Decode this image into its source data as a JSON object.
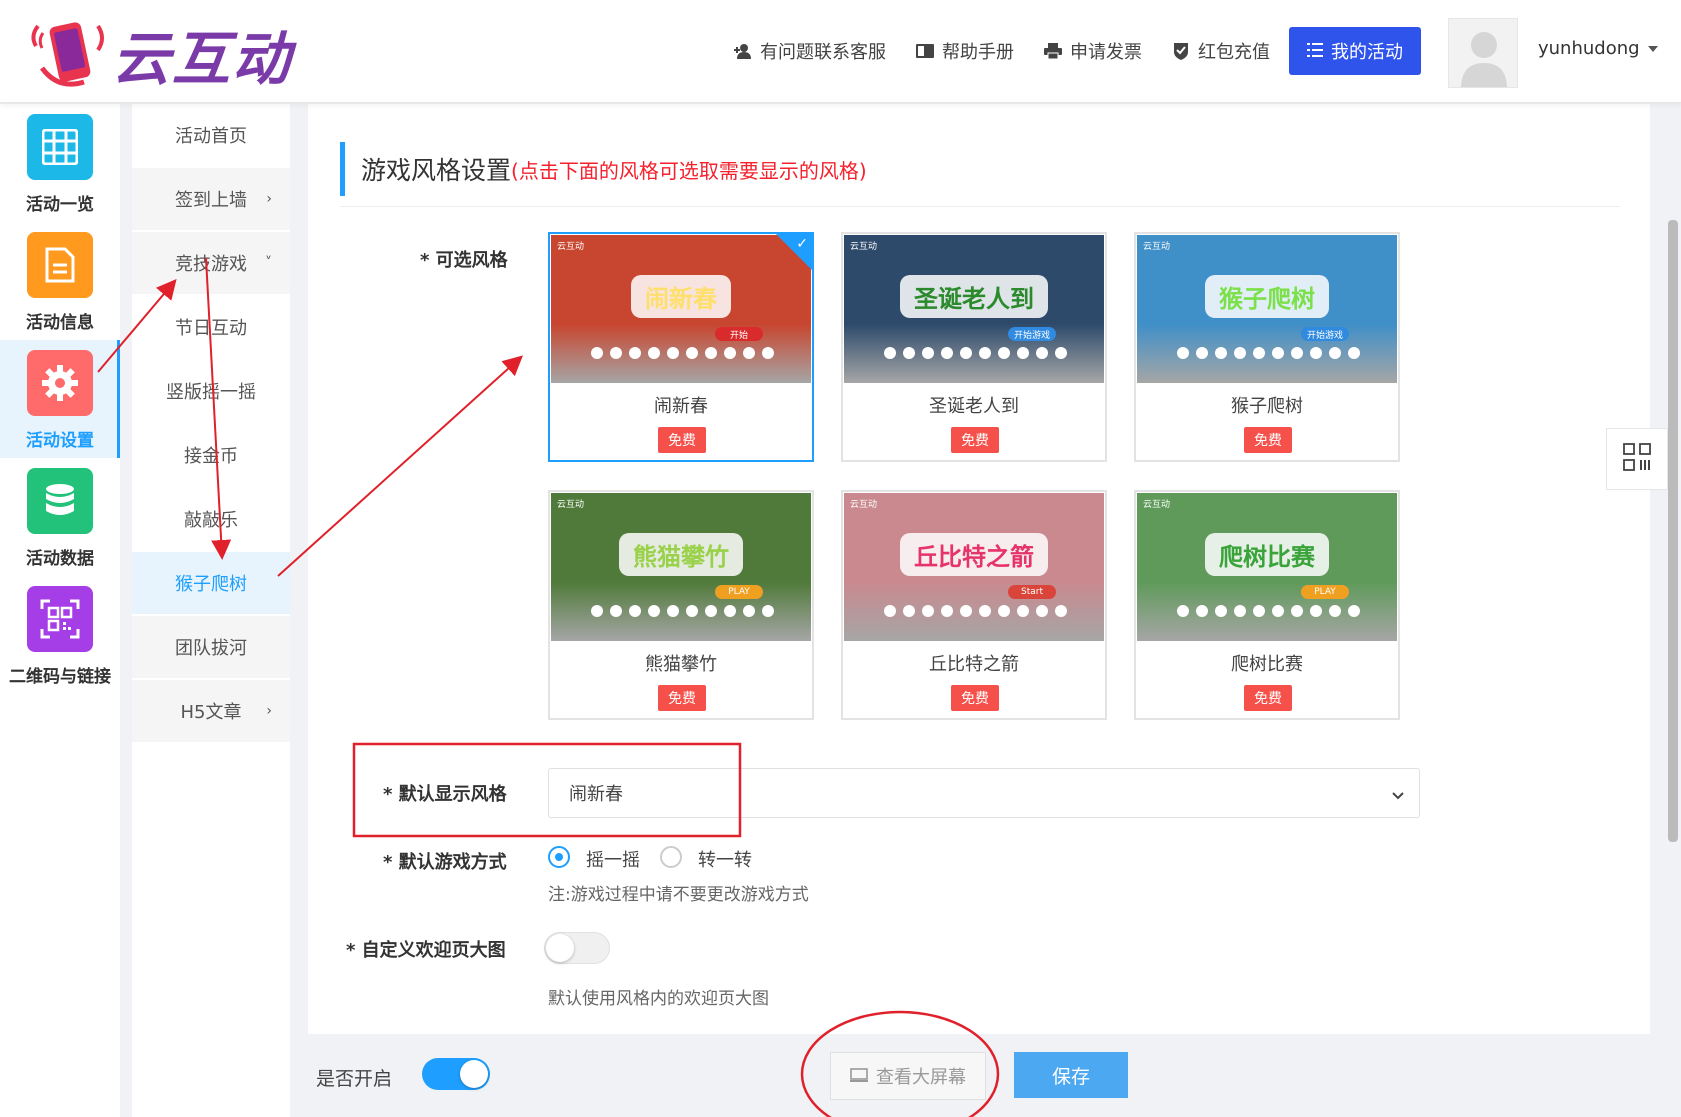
{
  "header": {
    "logo_text": "云互动",
    "links": [
      {
        "label": "有问题联系客服",
        "icon": "add-user-icon"
      },
      {
        "label": "帮助手册",
        "icon": "book-icon"
      },
      {
        "label": "申请发票",
        "icon": "printer-icon"
      },
      {
        "label": "红包充值",
        "icon": "shield-check-icon"
      }
    ],
    "my_activity_label": "我的活动",
    "username": "yunhudong"
  },
  "iconbar": {
    "items": [
      {
        "label": "活动一览",
        "color": "#1bb8e8",
        "icon": "grid-icon"
      },
      {
        "label": "活动信息",
        "color": "#ff9a1f",
        "icon": "document-icon"
      },
      {
        "label": "活动设置",
        "color": "#ff6b6b",
        "icon": "gear-icon",
        "active": true
      },
      {
        "label": "活动数据",
        "color": "#22c27a",
        "icon": "database-icon"
      },
      {
        "label": "二维码与链接",
        "color": "#a63ee8",
        "icon": "qrcode-icon"
      }
    ]
  },
  "submenu": {
    "items": [
      {
        "label": "活动首页"
      },
      {
        "label": "签到上墙",
        "chevron": "›"
      },
      {
        "label": "竞技游戏",
        "chevron": "˅"
      },
      {
        "label": "节日互动"
      },
      {
        "label": "竖版摇一摇"
      },
      {
        "label": "接金币"
      },
      {
        "label": "敲敲乐"
      },
      {
        "label": "猴子爬树",
        "active": true
      },
      {
        "label": "团队拔河"
      },
      {
        "label": "H5文章",
        "chevron": "›"
      }
    ]
  },
  "section": {
    "title": "游戏风格设置",
    "subtitle": "(点击下面的风格可选取需要显示的风格)"
  },
  "form": {
    "styles_label": "* 可选风格",
    "default_style_label": "* 默认显示风格",
    "default_style_value": "闹新春",
    "game_mode_label": "* 默认游戏方式",
    "mode_options": [
      "摇一摇",
      "转一转"
    ],
    "mode_selected": 0,
    "mode_note": "注:游戏过程中请不要更改游戏方式",
    "custom_welcome_label": "* 自定义欢迎页大图",
    "custom_welcome_enabled": false,
    "custom_welcome_note": "默认使用风格内的欢迎页大图"
  },
  "styles": [
    {
      "name": "闹新春",
      "badge": "免费",
      "selected": true,
      "thumb_title": "闹新春",
      "thumb_bg": "#c8452f",
      "thumb_btn": "开始",
      "thumb_brand": "云互动"
    },
    {
      "name": "圣诞老人到",
      "badge": "免费",
      "selected": false,
      "thumb_title": "圣诞老人到",
      "thumb_bg": "#2d4a6b",
      "thumb_btn": "开始游戏",
      "thumb_brand": "云互动"
    },
    {
      "name": "猴子爬树",
      "badge": "免费",
      "selected": false,
      "thumb_title": "猴子爬树",
      "thumb_bg": "#3f8fc8",
      "thumb_btn": "开始游戏",
      "thumb_brand": "云互动"
    },
    {
      "name": "熊猫攀竹",
      "badge": "免费",
      "selected": false,
      "thumb_title": "熊猫攀竹",
      "thumb_bg": "#4f7a3a",
      "thumb_btn": "PLAY",
      "thumb_brand": "云互动"
    },
    {
      "name": "丘比特之箭",
      "badge": "免费",
      "selected": false,
      "thumb_title": "丘比特之箭",
      "thumb_bg": "#c9898f",
      "thumb_btn": "Start",
      "thumb_brand": "云互动"
    },
    {
      "name": "爬树比赛",
      "badge": "免费",
      "selected": false,
      "thumb_title": "爬树比赛",
      "thumb_bg": "#5f9a5a",
      "thumb_btn": "PLAY",
      "thumb_brand": "云互动"
    }
  ],
  "bottom": {
    "enable_label": "是否开启",
    "enabled": true,
    "view_screen_label": "查看大屏幕",
    "save_label": "保存"
  },
  "colors": {
    "accent": "#1e9fff",
    "primary_button": "#2f54eb",
    "badge_red": "#f5504a",
    "annotation_red": "#e0202a"
  }
}
